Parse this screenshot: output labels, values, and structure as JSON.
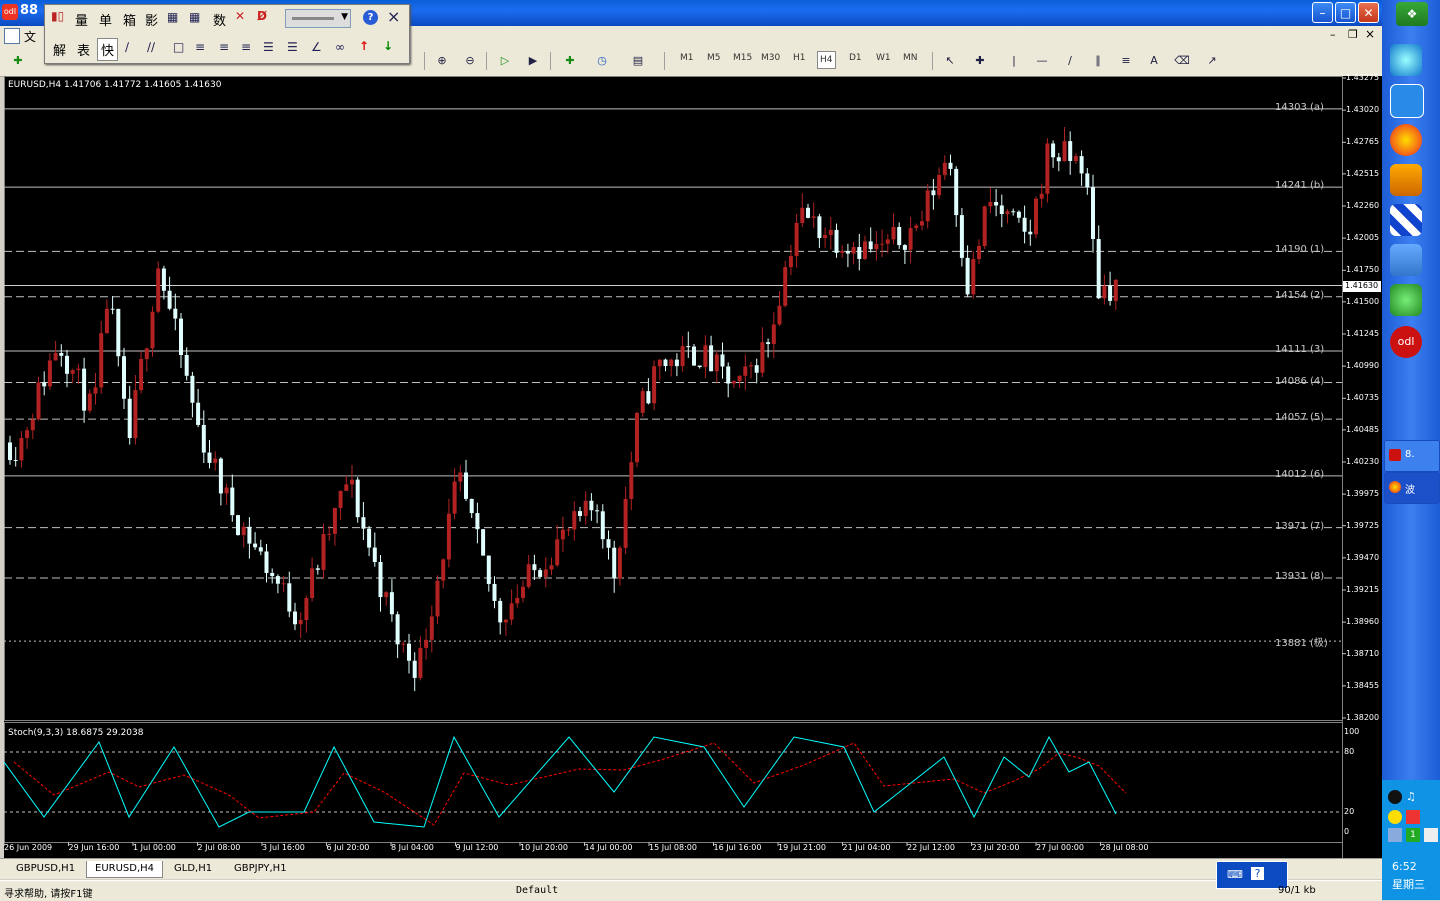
{
  "window": {
    "title": "88",
    "app_icon_text": "odl"
  },
  "menubar": {
    "first_item": "文"
  },
  "float_toolbar": {
    "row1": [
      "量",
      "单",
      "箱",
      "影",
      "数"
    ],
    "row2": [
      "解",
      "表",
      "快"
    ]
  },
  "toolbar": {
    "timeframes": [
      "M1",
      "M5",
      "M15",
      "M30",
      "H1",
      "H4",
      "D1",
      "W1",
      "MN"
    ],
    "active_timeframe": "H4",
    "text_tool": "A"
  },
  "chart": {
    "header": "EURUSD,H4  1.41706  1.41772  1.41605  1.41630",
    "symbol": "EURUSD",
    "timeframe": "H4",
    "ohlc": {
      "open": 1.41706,
      "high": 1.41772,
      "low": 1.41605,
      "close": 1.4163
    },
    "current_price": "1.41630",
    "price_axis": [
      "1.43275",
      "1.43020",
      "1.42765",
      "1.42515",
      "1.42260",
      "1.42005",
      "1.41750",
      "1.41500",
      "1.41245",
      "1.40990",
      "1.40735",
      "1.40485",
      "1.40230",
      "1.39975",
      "1.39725",
      "1.39470",
      "1.39215",
      "1.38960",
      "1.38710",
      "1.38455",
      "1.38200"
    ],
    "time_axis": [
      "26 Jun 2009",
      "29 Jun 16:00",
      "1 Jul 00:00",
      "2 Jul 08:00",
      "3 Jul 16:00",
      "6 Jul 20:00",
      "8 Jul 04:00",
      "9 Jul 12:00",
      "10 Jul 20:00",
      "14 Jul 00:00",
      "15 Jul 08:00",
      "16 Jul 16:00",
      "19 Jul 21:00",
      "21 Jul 04:00",
      "22 Jul 12:00",
      "23 Jul 20:00",
      "27 Jul 00:00",
      "28 Jul 08:00"
    ],
    "levels": [
      {
        "label": "14303 (a)",
        "price": 1.4303,
        "style": "solid"
      },
      {
        "label": "14241 (b)",
        "price": 1.4241,
        "style": "solid"
      },
      {
        "label": "14190 (1)",
        "price": 1.419,
        "style": "dashed"
      },
      {
        "label": "14154 (2)",
        "price": 1.4154,
        "style": "dashed"
      },
      {
        "label": "14111 (3)",
        "price": 1.4111,
        "style": "solid"
      },
      {
        "label": "14086 (4)",
        "price": 1.4086,
        "style": "dashed"
      },
      {
        "label": "14057 (5)",
        "price": 1.4057,
        "style": "dashed"
      },
      {
        "label": "14012 (6)",
        "price": 1.4012,
        "style": "solid"
      },
      {
        "label": "13971 (7)",
        "price": 1.3971,
        "style": "dashed"
      },
      {
        "label": "13931 (8)",
        "price": 1.3931,
        "style": "dashed"
      },
      {
        "label": "13881 (极)",
        "price": 1.3881,
        "style": "dotted"
      }
    ]
  },
  "stochastic": {
    "header": "Stoch(9,3,3) 18.6875 29.2038",
    "main_value": 18.6875,
    "signal_value": 29.2038,
    "axis": [
      "100",
      "80",
      "20",
      "0"
    ],
    "main_color": "#00ffff",
    "signal_color": "#ff0000"
  },
  "colors": {
    "bull": "#b22222",
    "bear": "#e0ffff"
  },
  "tabs": [
    "GBPUSD,H1",
    "EURUSD,H4",
    "GLD,H1",
    "GBPJPY,H1"
  ],
  "active_tab": "EURUSD,H4",
  "status": {
    "help": "寻求帮助, 请按F1键",
    "profile": "Default",
    "traffic": "90/1 kb"
  },
  "taskbar": {
    "time": "6:52",
    "day": "星期三",
    "task1": "8.",
    "task2": "波"
  }
}
